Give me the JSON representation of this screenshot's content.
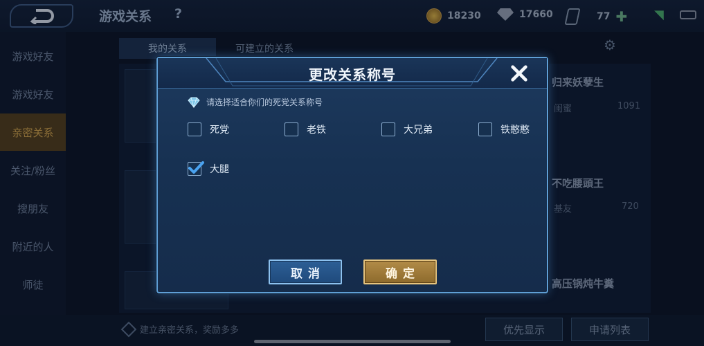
{
  "topbar": {
    "title": "游戏关系",
    "help": "?",
    "coins": "18230",
    "diamonds": "17660",
    "vouchers": "77",
    "plus": "✚"
  },
  "sidebar": {
    "items": [
      {
        "label": "游戏好友"
      },
      {
        "label": "游戏好友"
      },
      {
        "label": "亲密关系"
      },
      {
        "label": "关注/粉丝"
      },
      {
        "label": "搜朋友"
      },
      {
        "label": "附近的人"
      },
      {
        "label": "师徒"
      }
    ]
  },
  "tabs": [
    {
      "label": "我的关系"
    },
    {
      "label": "可建立的关系"
    }
  ],
  "background": {
    "friends": [
      {
        "name": "归来妖孽生",
        "tag": "闺蜜",
        "score": "1091"
      },
      {
        "name": "不吃腰頭王",
        "tag": "基友",
        "score": "720"
      },
      {
        "name": "高压锅炖牛糞",
        "tag": "",
        "score": ""
      }
    ]
  },
  "bottom": {
    "tip": "建立亲密关系，奖励多多",
    "priority_button": "优先显示",
    "apply_button": "申请列表"
  },
  "dialog": {
    "title": "更改关系称号",
    "prompt": "请选择适合你们的死党关系称号",
    "options": [
      {
        "label": "死党",
        "checked": false
      },
      {
        "label": "老铁",
        "checked": false
      },
      {
        "label": "大兄弟",
        "checked": false
      },
      {
        "label": "铁憨憨",
        "checked": false
      },
      {
        "label": "大腿",
        "checked": true
      }
    ],
    "cancel_label": "取消",
    "confirm_label": "确定"
  },
  "colors": {
    "dialog_border": "#5f9fd6",
    "cancel_button": "#2d5f96",
    "confirm_button": "#b28c48",
    "checkmark": "#4aa3f0"
  }
}
